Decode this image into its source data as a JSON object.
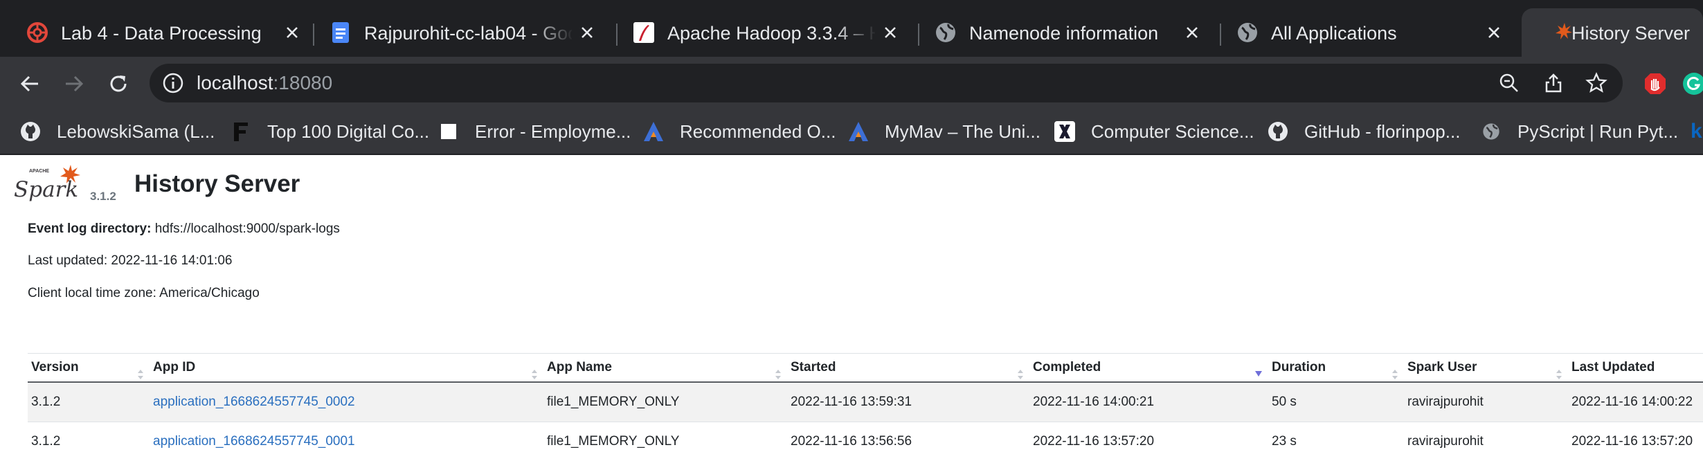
{
  "browser": {
    "tabs": [
      {
        "title": "Lab 4 - Data Processing",
        "icon": "openai-icon"
      },
      {
        "title": "Rajpurohit-cc-lab04 - Goog",
        "icon": "google-docs-icon"
      },
      {
        "title": "Apache Hadoop 3.3.4 – Ha",
        "icon": "apache-feather-icon"
      },
      {
        "title": "Namenode information",
        "icon": "globe-icon"
      },
      {
        "title": "All Applications",
        "icon": "globe-icon"
      },
      {
        "title": "History Server",
        "icon": "spark-favicon-icon"
      }
    ],
    "address_host": "localhost",
    "address_port": ":18080",
    "bookmarks": [
      {
        "label": "LebowskiSama (L...",
        "icon": "github-icon"
      },
      {
        "label": "Top 100 Digital Co...",
        "icon": "f-letter-icon"
      },
      {
        "label": "Error - Employme...",
        "icon": "white-square-icon"
      },
      {
        "label": "Recommended O...",
        "icon": "uta-icon"
      },
      {
        "label": "MyMav – The Uni...",
        "icon": "uta-icon"
      },
      {
        "label": "Computer Science...",
        "icon": "x-letter-icon"
      },
      {
        "label": "GitHub - florinpop...",
        "icon": "github-icon"
      },
      {
        "label": "PyScript | Run Pyt...",
        "icon": "globe-icon"
      }
    ]
  },
  "page": {
    "logo_text": "Spark",
    "logo_super": "APACHE",
    "version": "3.1.2",
    "title": "History Server",
    "event_log_label": "Event log directory:",
    "event_log_value": "hdfs://localhost:9000/spark-logs",
    "last_updated": "Last updated: 2022-11-16 14:01:06",
    "timezone": "Client local time zone: America/Chicago"
  },
  "table": {
    "headers": [
      "Version",
      "App ID",
      "App Name",
      "Started",
      "Completed",
      "Duration",
      "Spark User",
      "Last Updated"
    ],
    "rows": [
      {
        "version": "3.1.2",
        "app_id": "application_1668624557745_0002",
        "app_name": "file1_MEMORY_ONLY",
        "started": "2022-11-16 13:59:31",
        "completed": "2022-11-16 14:00:21",
        "duration": "50 s",
        "user": "ravirajpurohit",
        "last_updated": "2022-11-16 14:00:22"
      },
      {
        "version": "3.1.2",
        "app_id": "application_1668624557745_0001",
        "app_name": "file1_MEMORY_ONLY",
        "started": "2022-11-16 13:56:56",
        "completed": "2022-11-16 13:57:20",
        "duration": "23 s",
        "user": "ravirajpurohit",
        "last_updated": "2022-11-16 13:57:20"
      }
    ]
  },
  "colors": {
    "tab_strip": "#1f2023",
    "toolbar": "#35363a",
    "link": "#2a6fbf",
    "spark_orange": "#e25a1c"
  }
}
